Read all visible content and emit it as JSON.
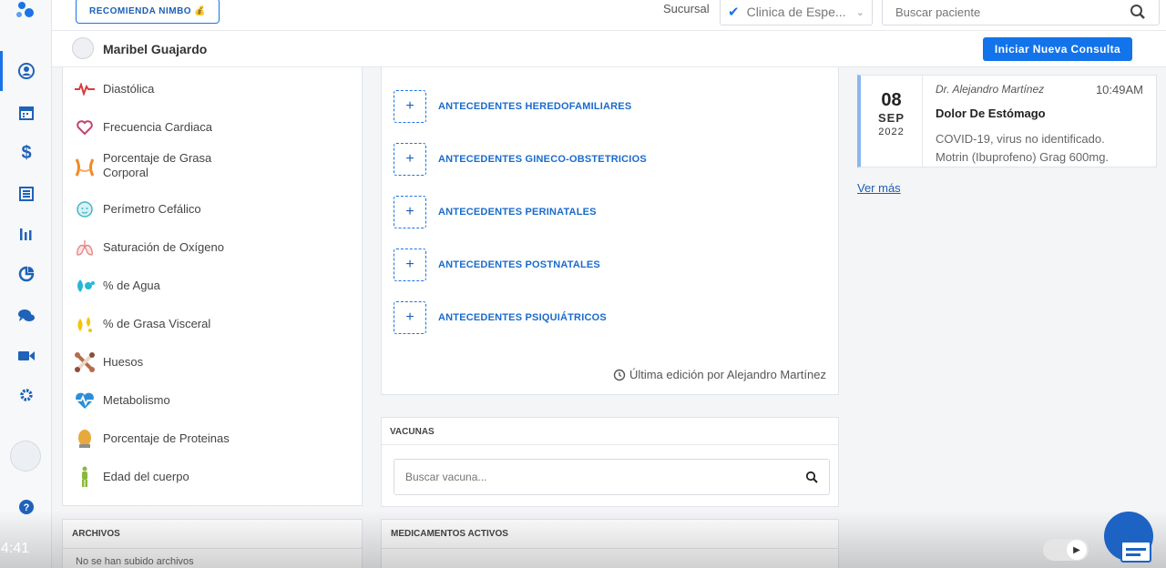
{
  "topbar": {
    "recommend_label": "RECOMIENDA NIMBO 💰",
    "sucursal_label": "Sucursal",
    "sucursal_value": "Clinica de Espe...",
    "search_placeholder": "Buscar paciente"
  },
  "patient": {
    "name": "Maribel Guajardo",
    "new_consult_label": "Iniciar Nueva Consulta"
  },
  "rail": {
    "icons": [
      "patient-icon",
      "calendar-icon",
      "dollar-icon",
      "list-icon",
      "bar-chart-icon",
      "pie-chart-icon",
      "chat-icon",
      "video-icon",
      "gear-icon",
      "help-icon"
    ]
  },
  "metrics": [
    {
      "label": "Diastólica",
      "icon": "heartbeat-icon"
    },
    {
      "label": "Frecuencia Cardiaca",
      "icon": "heart-icon"
    },
    {
      "label": "Porcentaje de Grasa Corporal",
      "icon": "waist-icon"
    },
    {
      "label": "Perímetro Cefálico",
      "icon": "baby-head-icon"
    },
    {
      "label": "Saturación de Oxígeno",
      "icon": "lungs-icon"
    },
    {
      "label": "% de Agua",
      "icon": "water-drops-icon"
    },
    {
      "label": "% de Grasa Visceral",
      "icon": "fat-drops-icon"
    },
    {
      "label": "Huesos",
      "icon": "bones-icon"
    },
    {
      "label": "Metabolismo",
      "icon": "heart-pulse-icon"
    },
    {
      "label": "Porcentaje de Proteinas",
      "icon": "egg-icon"
    },
    {
      "label": "Edad del cuerpo",
      "icon": "body-icon"
    }
  ],
  "antecedentes": {
    "items": [
      "ANTECEDENTES HEREDOFAMILIARES",
      "ANTECEDENTES GINECO-OBSTETRICIOS",
      "ANTECEDENTES PERINATALES",
      "ANTECEDENTES POSTNATALES",
      "ANTECEDENTES PSIQUIÁTRICOS"
    ],
    "last_edit": "Última edición por Alejandro Martínez"
  },
  "vacunas": {
    "title": "VACUNAS",
    "search_placeholder": "Buscar vacuna..."
  },
  "archivos": {
    "title": "ARCHIVOS",
    "empty_text": "No se han subido archivos"
  },
  "medicamentos": {
    "title": "MEDICAMENTOS ACTIVOS"
  },
  "consultation": {
    "day": "08",
    "month": "SEP",
    "year": "2022",
    "doctor": "Dr. Alejandro Martínez",
    "time": "10:49AM",
    "title": "Dolor De Estómago",
    "diagnosis": "COVID-19, virus no identificado.",
    "medication": "Motrin (Ibuprofeno) Grag 600mg.",
    "see_more": "Ver más"
  },
  "video": {
    "timecode": "4:41"
  },
  "colors": {
    "primary": "#1a73e8",
    "link": "#1a6bcc",
    "rail_icon": "#1f62b9"
  }
}
